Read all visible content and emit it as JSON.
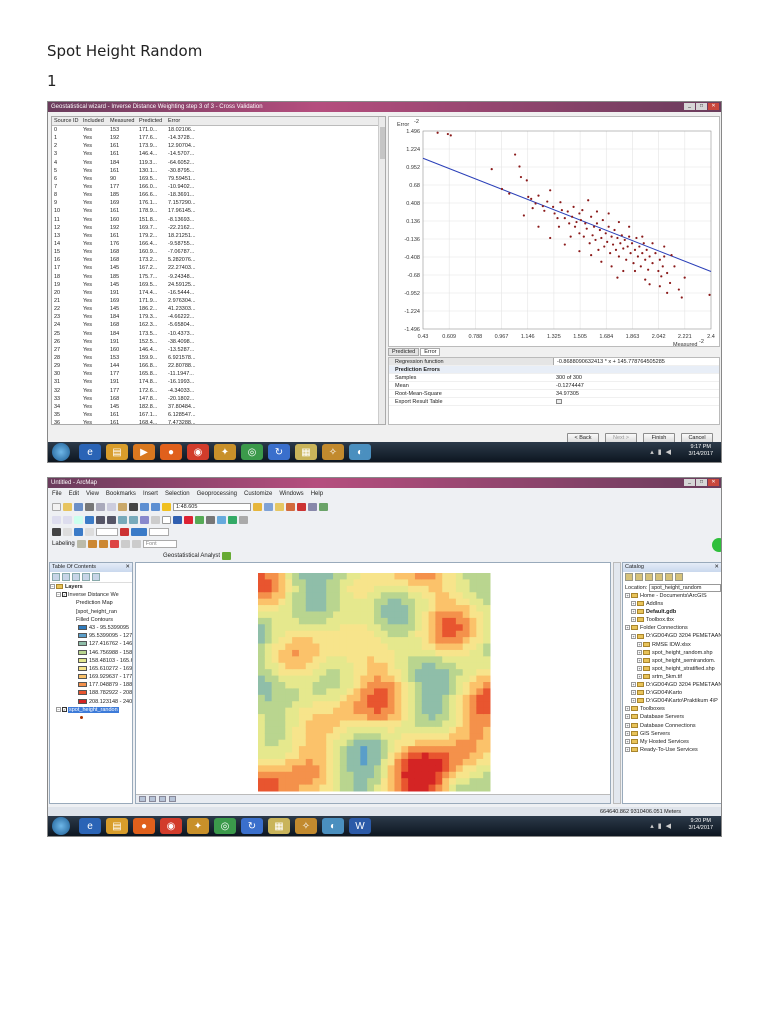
{
  "doc": {
    "title": "Spot Height Random",
    "number": "1"
  },
  "wizard": {
    "title": "Geostatistical wizard - Inverse Distance Weighting step 3 of 3 - Cross Validation",
    "columns": [
      "Source ID",
      "Included",
      "Measured",
      "Predicted",
      "Error"
    ],
    "rows": [
      [
        "0",
        "Yes",
        "153",
        "171.0...",
        "18.02106..."
      ],
      [
        "1",
        "Yes",
        "192",
        "177.6...",
        "-14.3728..."
      ],
      [
        "2",
        "Yes",
        "161",
        "173.9...",
        "12.90704..."
      ],
      [
        "3",
        "Yes",
        "161",
        "146.4...",
        "-14.5707..."
      ],
      [
        "4",
        "Yes",
        "184",
        "119.3...",
        "-64.6052..."
      ],
      [
        "5",
        "Yes",
        "161",
        "130.1...",
        "-30.8795..."
      ],
      [
        "6",
        "Yes",
        "90",
        "169.5...",
        "79.59451..."
      ],
      [
        "7",
        "Yes",
        "177",
        "166.0...",
        "-10.9402..."
      ],
      [
        "8",
        "Yes",
        "185",
        "166.6...",
        "-18.3691..."
      ],
      [
        "9",
        "Yes",
        "169",
        "176.1...",
        "7.157290..."
      ],
      [
        "10",
        "Yes",
        "161",
        "178.9...",
        "17.96145..."
      ],
      [
        "11",
        "Yes",
        "160",
        "151.8...",
        "-8.13693..."
      ],
      [
        "12",
        "Yes",
        "192",
        "169.7...",
        "-22.2162..."
      ],
      [
        "13",
        "Yes",
        "161",
        "179.2...",
        "18.21251..."
      ],
      [
        "14",
        "Yes",
        "176",
        "166.4...",
        "-9.58755..."
      ],
      [
        "15",
        "Yes",
        "168",
        "160.9...",
        "-7.06787..."
      ],
      [
        "16",
        "Yes",
        "168",
        "173.2...",
        "5.282076..."
      ],
      [
        "17",
        "Yes",
        "145",
        "167.2...",
        "22.27403..."
      ],
      [
        "18",
        "Yes",
        "185",
        "175.7...",
        "-9.24348..."
      ],
      [
        "19",
        "Yes",
        "145",
        "169.5...",
        "24.59125..."
      ],
      [
        "20",
        "Yes",
        "191",
        "174.4...",
        "-16.5444..."
      ],
      [
        "21",
        "Yes",
        "169",
        "171.9...",
        "2.976304..."
      ],
      [
        "22",
        "Yes",
        "145",
        "186.2...",
        "41.23303..."
      ],
      [
        "23",
        "Yes",
        "184",
        "179.3...",
        "-4.66222..."
      ],
      [
        "24",
        "Yes",
        "168",
        "162.3...",
        "-5.65804..."
      ],
      [
        "25",
        "Yes",
        "184",
        "173.5...",
        "-10.4373..."
      ],
      [
        "26",
        "Yes",
        "191",
        "152.5...",
        "-38.4098..."
      ],
      [
        "27",
        "Yes",
        "160",
        "146.4...",
        "-13.5287..."
      ],
      [
        "28",
        "Yes",
        "153",
        "159.9...",
        "6.921578..."
      ],
      [
        "29",
        "Yes",
        "144",
        "166.8...",
        "22.80788..."
      ],
      [
        "30",
        "Yes",
        "177",
        "165.8...",
        "-11.1947..."
      ],
      [
        "31",
        "Yes",
        "191",
        "174.8...",
        "-16.1993..."
      ],
      [
        "32",
        "Yes",
        "177",
        "172.6...",
        "-4.34033..."
      ],
      [
        "33",
        "Yes",
        "168",
        "147.8...",
        "-20.1802..."
      ],
      [
        "34",
        "Yes",
        "145",
        "182.8...",
        "37.80484..."
      ],
      [
        "35",
        "Yes",
        "161",
        "167.1...",
        "6.128547..."
      ],
      [
        "36",
        "Yes",
        "161",
        "168.4...",
        "7.473288..."
      ]
    ],
    "tabs": [
      "Predicted",
      "Error"
    ],
    "regression_label": "Regression function",
    "regression_value": "-0.8688090632413 * x + 145.778764505285",
    "prediction_errors_label": "Prediction Errors",
    "stats": [
      {
        "k": "Samples",
        "v": "300 of 300"
      },
      {
        "k": "Mean",
        "v": "-0.1274447"
      },
      {
        "k": "Root-Mean-Square",
        "v": "34.97305"
      }
    ],
    "export_label": "Export Result Table",
    "buttons": {
      "back": "< Back",
      "next": "Next >",
      "finish": "Finish",
      "cancel": "Cancel"
    },
    "clock": {
      "time": "9:17 PM",
      "date": "3/14/2017"
    }
  },
  "chart_data": {
    "type": "scatter",
    "ylabel": "Error",
    "ylabel_exp": "-2",
    "xlabel": "Measured",
    "xlabel_exp": "-2",
    "ylim": [
      -1.496,
      1.496
    ],
    "xlim": [
      0.43,
      2.4
    ],
    "y_ticks": [
      "1.496",
      "1.224",
      "0.952",
      "0.68",
      "0.408",
      "0.136",
      "-0.136",
      "-0.408",
      "-0.68",
      "-0.952",
      "-1.224",
      "-1.496"
    ],
    "x_ticks": [
      "0.43",
      "0.609",
      "0.788",
      "0.967",
      "1.146",
      "1.325",
      "1.505",
      "1.684",
      "1.863",
      "2.042",
      "2.221",
      "2.4"
    ],
    "regression": {
      "slope": -0.8688,
      "intercept": 1.4578
    },
    "point_color": "#8b1a1a",
    "line_color": "#2a3fb8",
    "points": [
      [
        0.53,
        1.47
      ],
      [
        0.6,
        1.45
      ],
      [
        0.62,
        1.43
      ],
      [
        0.9,
        0.92
      ],
      [
        1.06,
        1.14
      ],
      [
        1.14,
        0.75
      ],
      [
        1.09,
        0.96
      ],
      [
        1.1,
        0.8
      ],
      [
        1.15,
        0.5
      ],
      [
        1.17,
        0.47
      ],
      [
        1.2,
        0.4
      ],
      [
        1.18,
        0.33
      ],
      [
        1.22,
        0.52
      ],
      [
        1.25,
        0.36
      ],
      [
        1.26,
        0.29
      ],
      [
        1.28,
        0.43
      ],
      [
        1.3,
        0.6
      ],
      [
        1.32,
        0.35
      ],
      [
        1.33,
        0.25
      ],
      [
        1.35,
        0.18
      ],
      [
        1.37,
        0.42
      ],
      [
        1.38,
        0.3
      ],
      [
        1.4,
        0.18
      ],
      [
        1.42,
        0.28
      ],
      [
        1.43,
        0.1
      ],
      [
        1.45,
        0.2
      ],
      [
        1.46,
        0.35
      ],
      [
        1.47,
        0.05
      ],
      [
        1.48,
        0.12
      ],
      [
        1.5,
        0.25
      ],
      [
        1.5,
        -0.05
      ],
      [
        1.51,
        0.15
      ],
      [
        1.52,
        0.3
      ],
      [
        1.53,
        -0.1
      ],
      [
        1.54,
        0.1
      ],
      [
        1.55,
        0.02
      ],
      [
        1.56,
        0.45
      ],
      [
        1.57,
        -0.2
      ],
      [
        1.58,
        0.2
      ],
      [
        1.59,
        -0.08
      ],
      [
        1.6,
        0.05
      ],
      [
        1.61,
        -0.15
      ],
      [
        1.62,
        0.1
      ],
      [
        1.63,
        -0.3
      ],
      [
        1.64,
        0.0
      ],
      [
        1.65,
        -0.12
      ],
      [
        1.66,
        0.15
      ],
      [
        1.67,
        -0.25
      ],
      [
        1.68,
        -0.05
      ],
      [
        1.69,
        -0.18
      ],
      [
        1.7,
        0.05
      ],
      [
        1.71,
        -0.35
      ],
      [
        1.72,
        -0.1
      ],
      [
        1.73,
        -0.22
      ],
      [
        1.74,
        0.0
      ],
      [
        1.75,
        -0.3
      ],
      [
        1.76,
        -0.12
      ],
      [
        1.77,
        -0.4
      ],
      [
        1.78,
        -0.2
      ],
      [
        1.79,
        -0.08
      ],
      [
        1.8,
        -0.28
      ],
      [
        1.81,
        -0.15
      ],
      [
        1.82,
        -0.45
      ],
      [
        1.83,
        -0.25
      ],
      [
        1.84,
        -0.1
      ],
      [
        1.85,
        -0.35
      ],
      [
        1.86,
        -0.2
      ],
      [
        1.87,
        -0.5
      ],
      [
        1.88,
        -0.3
      ],
      [
        1.89,
        -0.12
      ],
      [
        1.9,
        -0.4
      ],
      [
        1.91,
        -0.25
      ],
      [
        1.92,
        -0.55
      ],
      [
        1.93,
        -0.35
      ],
      [
        1.94,
        -0.2
      ],
      [
        1.95,
        -0.45
      ],
      [
        1.96,
        -0.3
      ],
      [
        1.97,
        -0.6
      ],
      [
        1.98,
        -0.4
      ],
      [
        2.0,
        -0.5
      ],
      [
        2.02,
        -0.35
      ],
      [
        2.04,
        -0.62
      ],
      [
        2.05,
        -0.45
      ],
      [
        2.06,
        -0.7
      ],
      [
        2.07,
        -0.55
      ],
      [
        2.08,
        -0.4
      ],
      [
        2.1,
        -0.65
      ],
      [
        2.12,
        -0.8
      ],
      [
        2.15,
        -0.55
      ],
      [
        2.18,
        -0.9
      ],
      [
        2.2,
        -1.02
      ],
      [
        2.22,
        -0.72
      ],
      [
        2.05,
        -0.85
      ],
      [
        1.95,
        -0.75
      ],
      [
        1.8,
        -0.62
      ],
      [
        1.72,
        -0.55
      ],
      [
        1.65,
        -0.48
      ],
      [
        1.58,
        -0.38
      ],
      [
        1.5,
        -0.32
      ],
      [
        1.4,
        -0.22
      ],
      [
        1.3,
        -0.12
      ],
      [
        1.22,
        0.05
      ],
      [
        1.12,
        0.22
      ],
      [
        1.02,
        0.55
      ],
      [
        0.97,
        0.62
      ],
      [
        1.36,
        0.05
      ],
      [
        1.44,
        -0.1
      ],
      [
        1.62,
        0.28
      ],
      [
        1.7,
        0.25
      ],
      [
        1.77,
        0.12
      ],
      [
        1.84,
        0.05
      ],
      [
        1.93,
        -0.1
      ],
      [
        2.0,
        -0.2
      ],
      [
        2.08,
        -0.25
      ],
      [
        2.13,
        -0.38
      ],
      [
        1.88,
        -0.62
      ],
      [
        1.98,
        -0.82
      ],
      [
        2.1,
        -0.95
      ],
      [
        2.39,
        -0.98
      ],
      [
        1.76,
        -0.72
      ]
    ]
  },
  "arcmap": {
    "title": "Untitled - ArcMap",
    "menu": [
      "File",
      "Edit",
      "View",
      "Bookmarks",
      "Insert",
      "Selection",
      "Geoprocessing",
      "Customize",
      "Windows",
      "Help"
    ],
    "scale": "1:48.605",
    "labeling": "Labeling",
    "font_combo": "Font",
    "geo_analyst": "Geostatistical Analyst",
    "toc": {
      "header": "Table Of Contents",
      "layers": "Layers",
      "idw_layer": "Inverse Distance We",
      "prediction_map": "Prediction Map",
      "sub_layer": "[spot_height_ran",
      "filled_contours": "Filled Contours",
      "classes": [
        {
          "label": "43 - 95.5399095",
          "color": "#2f7bbd"
        },
        {
          "label": "95.5399095 - 127",
          "color": "#5a9ec9"
        },
        {
          "label": "127.416762 - 146",
          "color": "#8fbea9"
        },
        {
          "label": "146.756988 - 158",
          "color": "#b9d58f"
        },
        {
          "label": "158.48103 - 165.6",
          "color": "#e5e88d"
        },
        {
          "label": "165.610272 - 169",
          "color": "#f7e48b"
        },
        {
          "label": "169.929637 - 177",
          "color": "#fbc26a"
        },
        {
          "label": "177.048879 - 188",
          "color": "#f4914b"
        },
        {
          "label": "188.782922 - 208",
          "color": "#e8552f"
        },
        {
          "label": "208.123148 - 240",
          "color": "#d42424"
        }
      ],
      "points_layer": "spot_height_randon"
    },
    "catalog": {
      "header": "Catalog",
      "location_label": "Location:",
      "location_value": "spot_height_random",
      "items": [
        "Home - Documents\\ArcGIS",
        "AddIns",
        "Default.gdb",
        "Toolbox.tbx",
        "Folder Connections",
        "D:\\GD04\\GD 3204 PEMETAAN",
        "RMSE IDW.xlsx",
        "spot_height_random.shp",
        "spot_height_semirandom.",
        "spot_height_stratified.shp",
        "srtm_5km.tif",
        "D:\\GD04\\GD 3204 PEMETAAN",
        "D:\\GD04\\Karto",
        "D:\\GD04\\Karto\\Praktikum 4\\P",
        "Toolboxes",
        "Database Servers",
        "Database Connections",
        "GIS Servers",
        "My Hosted Services",
        "Ready-To-Use Services"
      ]
    },
    "status_coords": "664640.862  9310406.051 Meters",
    "clock": {
      "time": "9:20 PM",
      "date": "3/14/2017"
    }
  }
}
